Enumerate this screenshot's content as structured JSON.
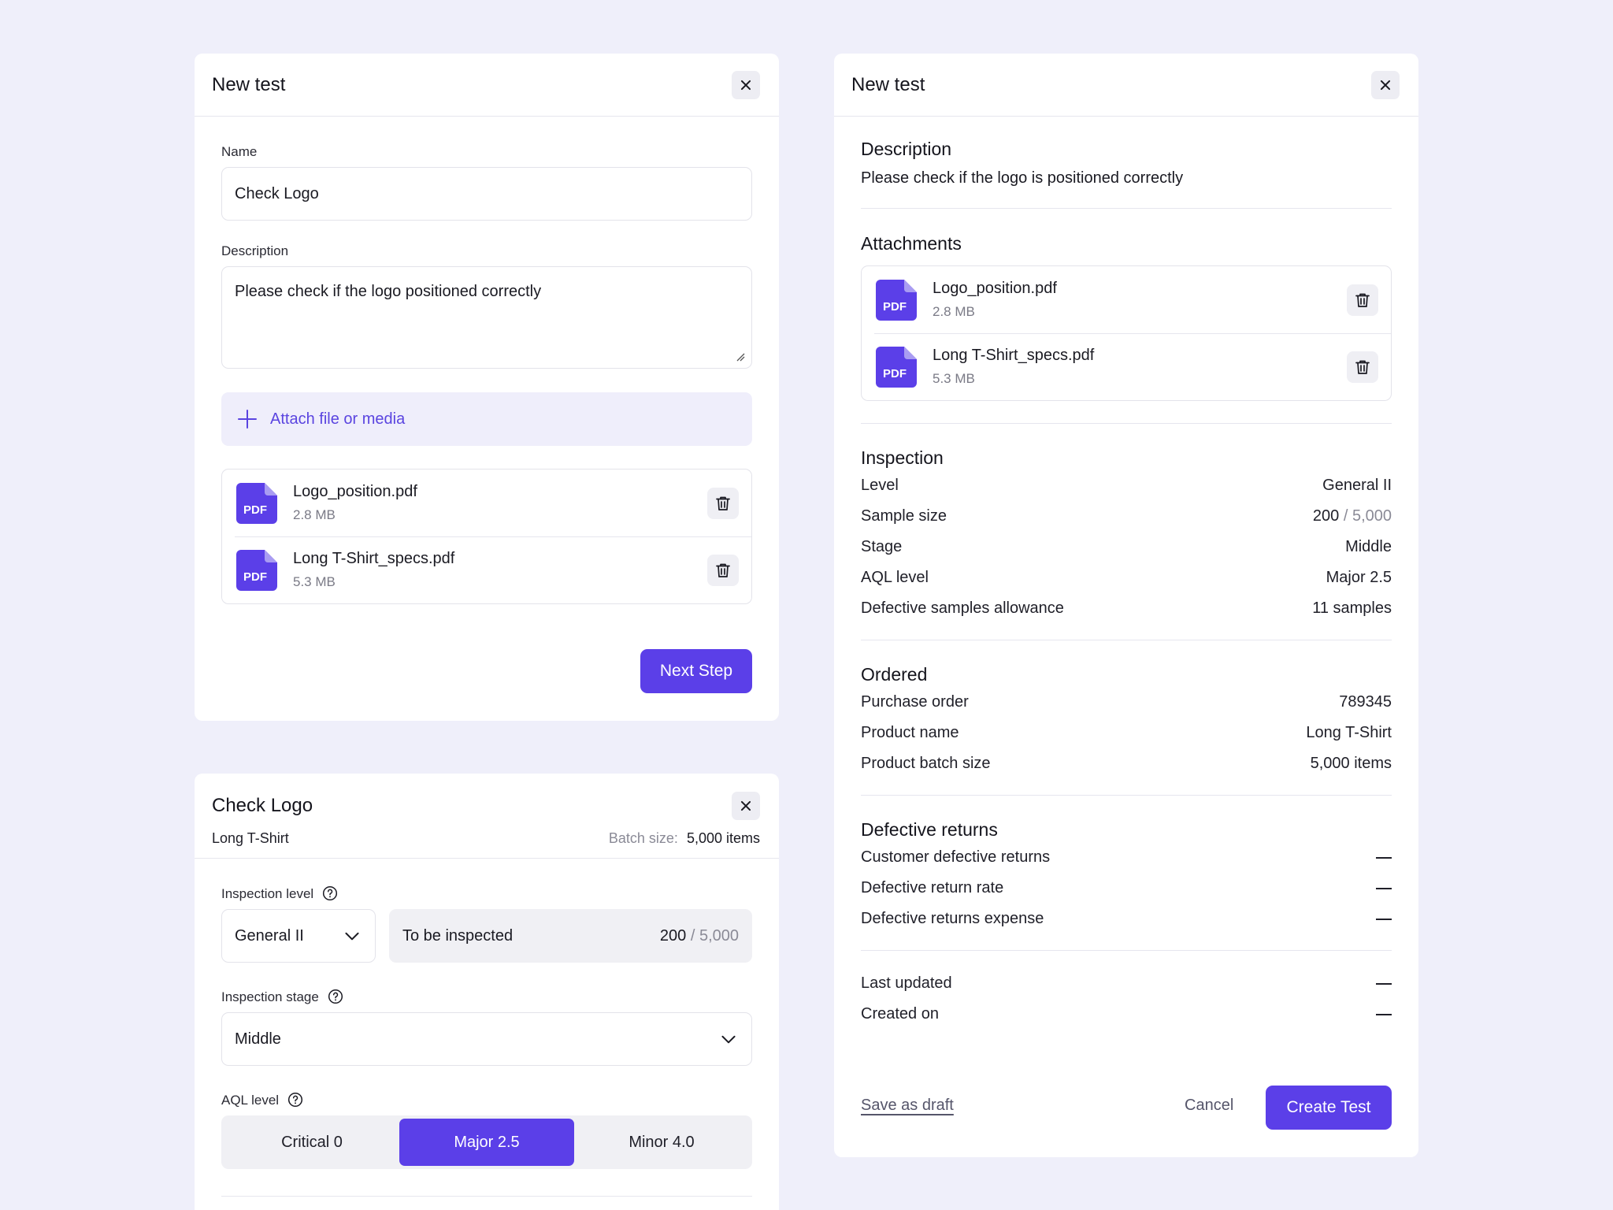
{
  "colors": {
    "background": "#efeffa",
    "accent": "#5b3fe8",
    "accent_soft": "#efeefb"
  },
  "card1": {
    "title": "New test",
    "name_label": "Name",
    "name_value": "Check Logo",
    "description_label": "Description",
    "description_value": "Please check if the logo positioned correctly",
    "attach_label": "Attach file or media",
    "files": [
      {
        "icon": "pdf-icon",
        "badge": "PDF",
        "name": "Logo_position.pdf",
        "size": "2.8 MB"
      },
      {
        "icon": "pdf-icon",
        "badge": "PDF",
        "name": "Long T-Shirt_specs.pdf",
        "size": "5.3 MB"
      }
    ],
    "next_label": "Next Step"
  },
  "card2": {
    "title": "Check Logo",
    "subtitle": "Long T-Shirt",
    "batch_label": "Batch size:",
    "batch_value": "5,000 items",
    "inspection_level_label": "Inspection level",
    "inspection_level_value": "General II",
    "to_inspect_label": "To be inspected",
    "to_inspect_count": "200",
    "to_inspect_total": "/ 5,000",
    "inspection_stage_label": "Inspection stage",
    "inspection_stage_value": "Middle",
    "aql_label": "AQL level",
    "aql_options": [
      "Critical 0",
      "Major 2.5",
      "Minor 4.0"
    ],
    "aql_selected": "Major 2.5"
  },
  "card3": {
    "title": "New test",
    "description_title": "Description",
    "description_text": "Please check if the logo is positioned correctly",
    "attachments_title": "Attachments",
    "files": [
      {
        "icon": "pdf-icon",
        "badge": "PDF",
        "name": "Logo_position.pdf",
        "size": "2.8 MB"
      },
      {
        "icon": "pdf-icon",
        "badge": "PDF",
        "name": "Long T-Shirt_specs.pdf",
        "size": "5.3 MB"
      }
    ],
    "inspection_title": "Inspection",
    "inspection": [
      {
        "label": "Level",
        "value": "General II"
      },
      {
        "label": "Sample size",
        "value": "200",
        "suffix": "/ 5,000"
      },
      {
        "label": "Stage",
        "value": "Middle"
      },
      {
        "label": "AQL level",
        "value": "Major 2.5"
      },
      {
        "label": "Defective samples allowance",
        "value": "11 samples"
      }
    ],
    "ordered_title": "Ordered",
    "ordered": [
      {
        "label": "Purchase order",
        "value": "789345"
      },
      {
        "label": "Product name",
        "value": "Long T-Shirt"
      },
      {
        "label": "Product batch size",
        "value": "5,000 items"
      }
    ],
    "returns_title": "Defective returns",
    "returns": [
      {
        "label": "Customer defective returns"
      },
      {
        "label": "Defective return rate"
      },
      {
        "label": "Defective returns expense"
      }
    ],
    "meta": [
      {
        "label": "Last updated"
      },
      {
        "label": "Created on"
      }
    ],
    "save_draft_label": "Save as draft",
    "cancel_label": "Cancel",
    "create_label": "Create Test"
  }
}
